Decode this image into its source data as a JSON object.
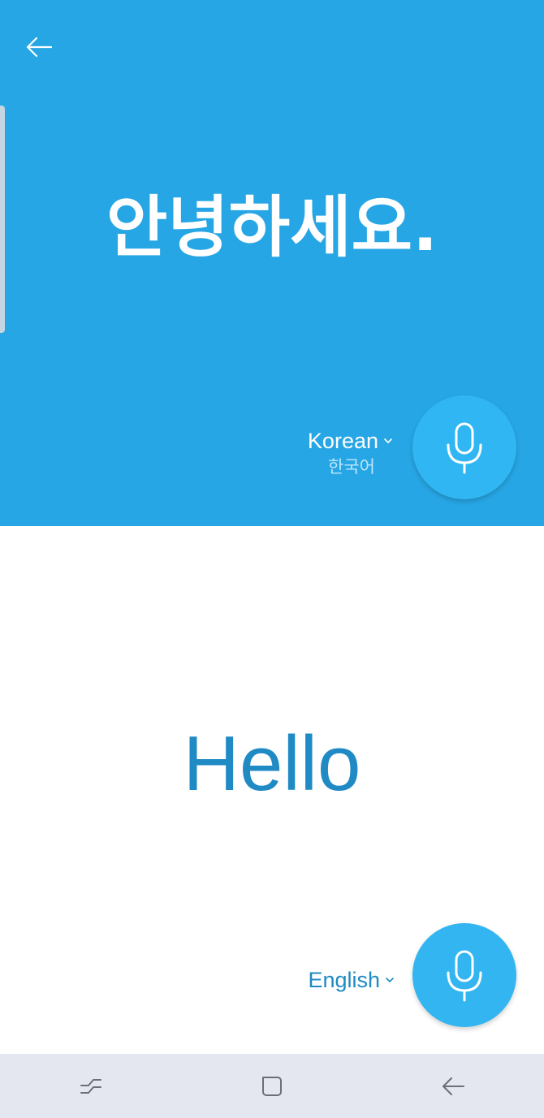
{
  "source": {
    "text": "안녕하세요.",
    "language": "Korean",
    "language_native": "한국어"
  },
  "target": {
    "text": "Hello",
    "language": "English"
  },
  "icons": {
    "back": "back-arrow-icon",
    "mic": "microphone-icon",
    "dropdown": "chevron-down-icon",
    "nav_recents": "recents-icon",
    "nav_home": "home-icon",
    "nav_back": "nav-back-icon"
  },
  "colors": {
    "top_panel": "#27a6e5",
    "mic_button": "#30b6f2",
    "target_text": "#1f8ac3",
    "nav_bar": "#e4e7ef"
  }
}
